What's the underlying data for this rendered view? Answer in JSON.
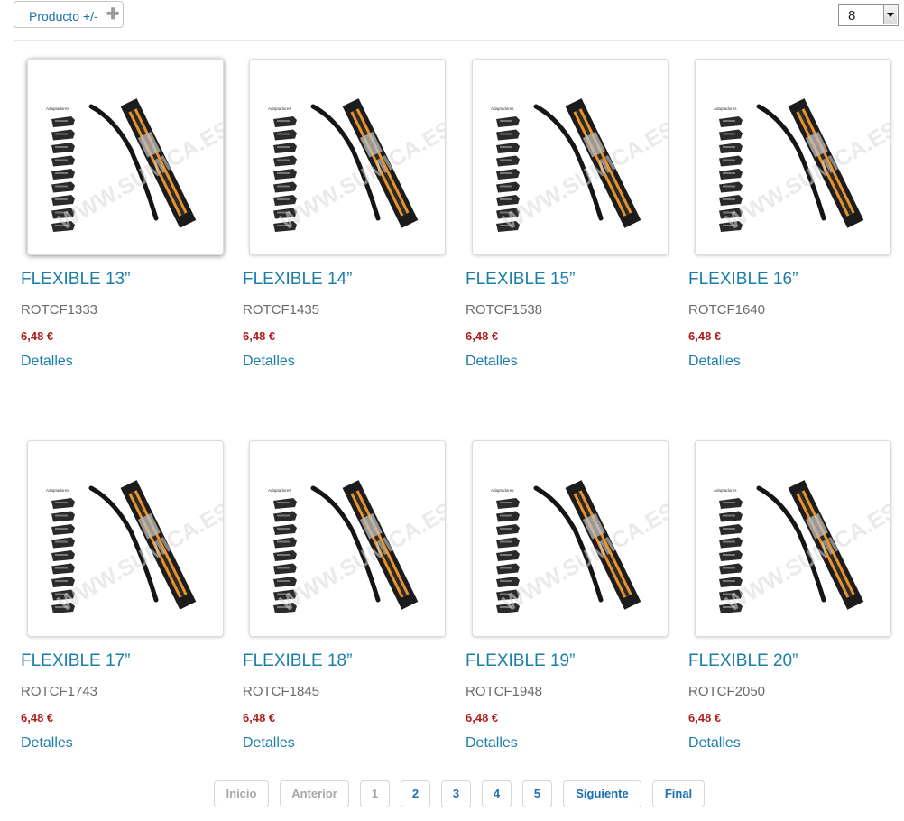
{
  "toolbar": {
    "sort_label": "Producto +/-",
    "per_page_value": "8"
  },
  "products": [
    {
      "title": "FLEXIBLE 13”",
      "ref": "ROTCF1333",
      "price": "6,48 €",
      "details": "Detalles"
    },
    {
      "title": "FLEXIBLE 14”",
      "ref": "ROTCF1435",
      "price": "6,48 €",
      "details": "Detalles"
    },
    {
      "title": "FLEXIBLE 15”",
      "ref": "ROTCF1538",
      "price": "6,48 €",
      "details": "Detalles"
    },
    {
      "title": "FLEXIBLE 16”",
      "ref": "ROTCF1640",
      "price": "6,48 €",
      "details": "Detalles"
    },
    {
      "title": "FLEXIBLE 17”",
      "ref": "ROTCF1743",
      "price": "6,48 €",
      "details": "Detalles"
    },
    {
      "title": "FLEXIBLE 18”",
      "ref": "ROTCF1845",
      "price": "6,48 €",
      "details": "Detalles"
    },
    {
      "title": "FLEXIBLE 19”",
      "ref": "ROTCF1948",
      "price": "6,48 €",
      "details": "Detalles"
    },
    {
      "title": "FLEXIBLE 20”",
      "ref": "ROTCF2050",
      "price": "6,48 €",
      "details": "Detalles"
    }
  ],
  "thumbnail": {
    "caption": "Adaptadores",
    "watermark": "WWW.SUMICA.ES",
    "blade_accent": "#e8922a"
  },
  "pagination": {
    "first": "Inicio",
    "prev": "Anterior",
    "pages": [
      "1",
      "2",
      "3",
      "4",
      "5"
    ],
    "next": "Siguiente",
    "last": "Final"
  },
  "colors": {
    "link": "#1a7ea8",
    "price": "#b01c1c"
  }
}
